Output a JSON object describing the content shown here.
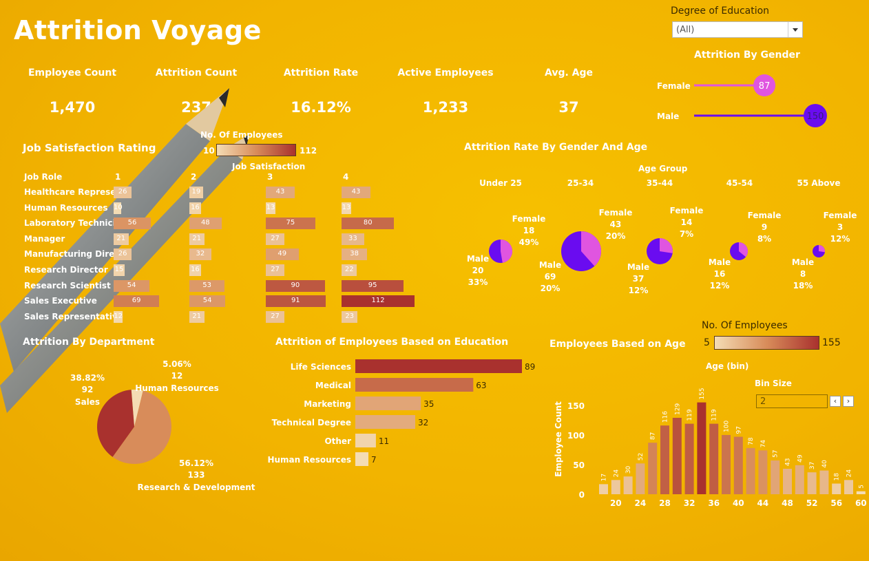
{
  "title": "Attrition Voyage",
  "filter": {
    "label": "Degree of Education",
    "value": "(All)"
  },
  "kpis": [
    {
      "label": "Employee Count",
      "value": "1,470"
    },
    {
      "label": "Attrition Count",
      "value": "237"
    },
    {
      "label": "Attrition Rate",
      "value": "16.12%"
    },
    {
      "label": "Active Employees",
      "value": "1,233"
    },
    {
      "label": "Avg. Age",
      "value": "37"
    }
  ],
  "colors": {
    "female": "#e055e0",
    "male": "#6a0cf0",
    "bar_low": "#f4dcb4",
    "bar_mid": "#d88c5a",
    "bar_high": "#a9312e",
    "background": "#f4b800"
  },
  "icons": {
    "filter_dropdown": "chevron-down-icon",
    "bin_prev": "chevron-left-icon",
    "bin_next": "chevron-right-icon"
  },
  "chart_data": [
    {
      "id": "gender",
      "type": "scatter",
      "title": "Attrition By Gender",
      "categories": [
        "Female",
        "Male"
      ],
      "values": [
        87,
        150
      ]
    },
    {
      "id": "job_satisfaction",
      "type": "heatmap",
      "title": "Job Satisfaction Rating",
      "row_header": "Job Role",
      "col_header": "Job Satisfaction",
      "legend_title": "No. Of Employees",
      "legend_min": "10",
      "legend_max": "112",
      "columns": [
        "1",
        "2",
        "3",
        "4"
      ],
      "rows": [
        {
          "role": "Healthcare Represe..",
          "values": [
            26,
            19,
            43,
            43
          ]
        },
        {
          "role": "Human Resources",
          "values": [
            10,
            16,
            13,
            13
          ]
        },
        {
          "role": "Laboratory Technici..",
          "values": [
            56,
            48,
            75,
            80
          ]
        },
        {
          "role": "Manager",
          "values": [
            21,
            21,
            27,
            33
          ]
        },
        {
          "role": "Manufacturing Dire..",
          "values": [
            26,
            32,
            49,
            38
          ]
        },
        {
          "role": "Research Director",
          "values": [
            15,
            16,
            27,
            22
          ]
        },
        {
          "role": "Research Scientist",
          "values": [
            54,
            53,
            90,
            95
          ]
        },
        {
          "role": "Sales Executive",
          "values": [
            69,
            54,
            91,
            112
          ]
        },
        {
          "role": "Sales Representative",
          "values": [
            12,
            21,
            27,
            23
          ]
        }
      ]
    },
    {
      "id": "gender_age",
      "type": "pie",
      "title": "Attrition Rate By Gender And Age",
      "group_header": "Age Group",
      "groups": [
        {
          "name": "Under 25",
          "female": {
            "label": "Female",
            "count": "18",
            "pct": "49%"
          },
          "male": {
            "label": "Male",
            "count": "20",
            "pct": "33%"
          }
        },
        {
          "name": "25-34",
          "female": {
            "label": "Female",
            "count": "43",
            "pct": "20%"
          },
          "male": {
            "label": "Male",
            "count": "69",
            "pct": "20%"
          }
        },
        {
          "name": "35-44",
          "female": {
            "label": "Female",
            "count": "14",
            "pct": "7%"
          },
          "male": {
            "label": "Male",
            "count": "37",
            "pct": "12%"
          }
        },
        {
          "name": "45-54",
          "female": {
            "label": "Female",
            "count": "9",
            "pct": "8%"
          },
          "male": {
            "label": "Male",
            "count": "16",
            "pct": "12%"
          }
        },
        {
          "name": "55 Above",
          "female": {
            "label": "Female",
            "count": "3",
            "pct": "12%"
          },
          "male": {
            "label": "Male",
            "count": "8",
            "pct": "18%"
          }
        }
      ]
    },
    {
      "id": "department",
      "type": "pie",
      "title": "Attrition By Department",
      "slices": [
        {
          "name": "Sales",
          "value": 92,
          "pct": "38.82%"
        },
        {
          "name": "Human Resources",
          "value": 12,
          "pct": "5.06%"
        },
        {
          "name": "Research & Development",
          "value": 133,
          "pct": "56.12%"
        }
      ]
    },
    {
      "id": "education",
      "type": "bar",
      "title": "Attrition of Employees Based on Education",
      "categories": [
        "Life Sciences",
        "Medical",
        "Marketing",
        "Technical Degree",
        "Other",
        "Human Resources"
      ],
      "values": [
        89,
        63,
        35,
        32,
        11,
        7
      ]
    },
    {
      "id": "age",
      "type": "bar",
      "title": "Employees Based on Age",
      "xlabel": "Age (bin)",
      "ylabel": "Employee Count",
      "legend_title": "No. Of Employees",
      "legend_min": "5",
      "legend_max": "155",
      "bin_size_label": "Bin Size",
      "bin_size": "2",
      "ylim": [
        0,
        165
      ],
      "yticks": [
        0,
        50,
        100,
        150
      ],
      "xticks": [
        "20",
        "24",
        "28",
        "32",
        "36",
        "40",
        "44",
        "48",
        "52",
        "56",
        "60"
      ],
      "x": [
        18,
        20,
        22,
        24,
        26,
        28,
        30,
        32,
        34,
        36,
        38,
        40,
        42,
        44,
        46,
        48,
        50,
        52,
        54,
        56,
        58,
        60
      ],
      "values": [
        17,
        24,
        30,
        52,
        87,
        116,
        129,
        119,
        155,
        119,
        100,
        97,
        78,
        74,
        57,
        43,
        49,
        37,
        40,
        18,
        24,
        5
      ]
    }
  ]
}
